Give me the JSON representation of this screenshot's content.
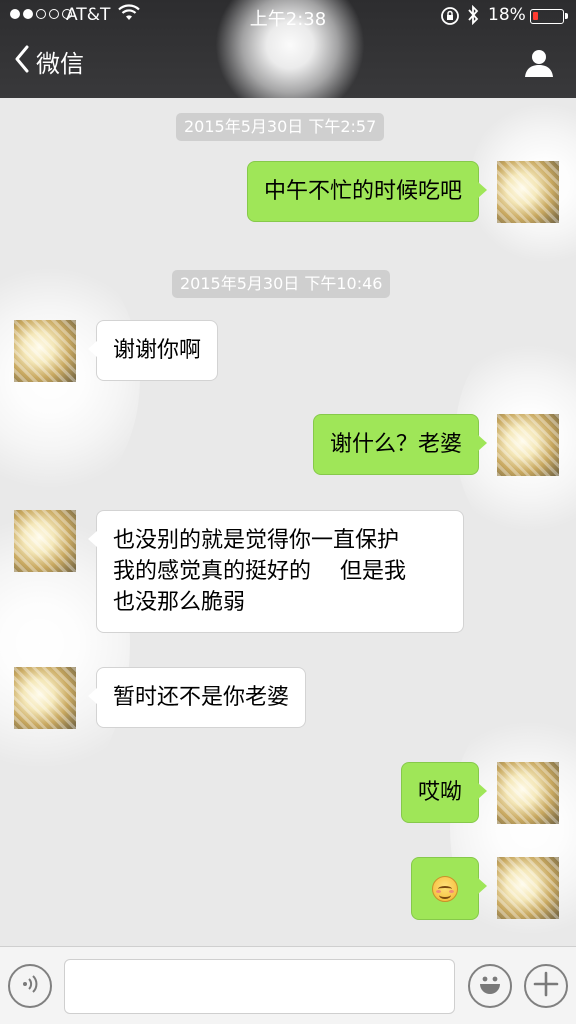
{
  "status_bar": {
    "carrier": "AT&T",
    "signal_filled": 2,
    "signal_total": 5,
    "time": "上午2:38",
    "battery_percent": "18%",
    "battery_level": 0.18,
    "icons": [
      "wifi-icon",
      "rotation-lock-icon",
      "bluetooth-icon",
      "battery-icon"
    ]
  },
  "nav": {
    "back_label": "微信",
    "back_icon": "chevron-left-icon",
    "right_icon": "profile-icon"
  },
  "chat": {
    "timestamps": [
      "2015年5月30日 下午2:57",
      "2015年5月30日 下午10:46"
    ],
    "messages": [
      {
        "side": "out",
        "text": "中午不忙的时候吃吧"
      },
      {
        "side": "in",
        "text": "谢谢你啊"
      },
      {
        "side": "out",
        "text": "谢什么？老婆"
      },
      {
        "side": "in",
        "lines": [
          "也没别的就是觉得你一直保护",
          "我的感觉真的挺好的　 但是我",
          "也没那么脆弱"
        ]
      },
      {
        "side": "in",
        "text": "暂时还不是你老婆"
      },
      {
        "side": "out",
        "text": "哎呦"
      },
      {
        "side": "out",
        "emoji": "smiling-face-emoji"
      }
    ]
  },
  "input_bar": {
    "voice_icon": "voice-icon",
    "text_value": "",
    "emoji_icon": "emoji-icon",
    "plus_icon": "plus-icon"
  },
  "colors": {
    "outgoing_bubble": "#9fe658",
    "incoming_bubble": "#ffffff",
    "nav_background": "#333335",
    "chat_background": "#e9e9e9",
    "battery_low": "#ff3b30"
  }
}
